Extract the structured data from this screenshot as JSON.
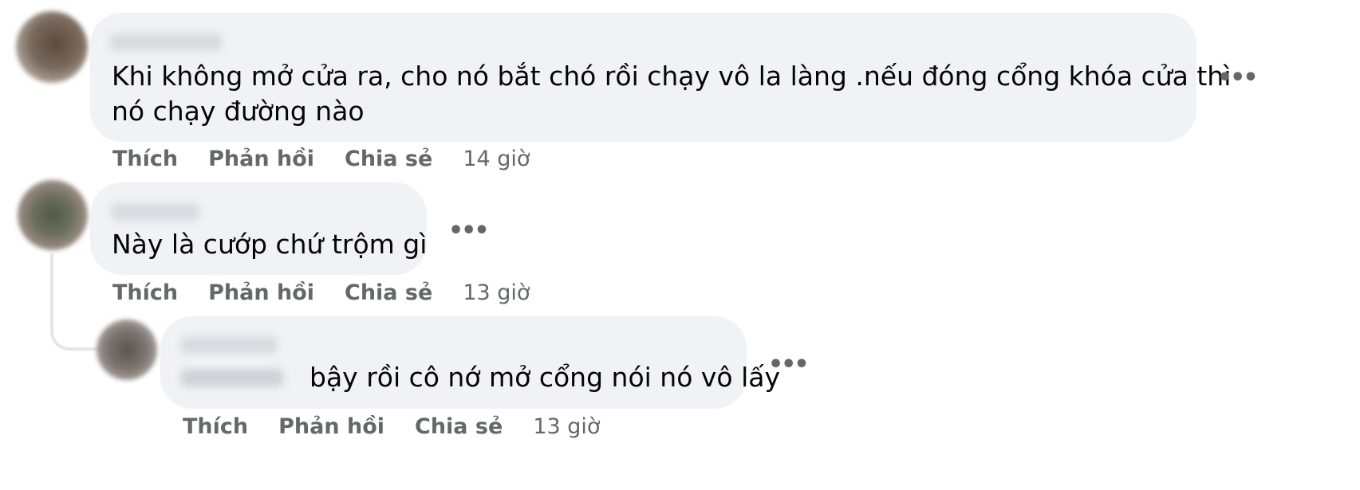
{
  "comments": [
    {
      "text_line1": "Khi không mở cửa ra, cho nó bắt chó rồi chạy vô la làng .nếu đóng cổng khóa cửa thì",
      "text_line2": "nó chạy đường nào",
      "actions": {
        "like": "Thích",
        "reply": "Phản hồi",
        "share": "Chia sẻ"
      },
      "time": "14 giờ",
      "more": "•••"
    },
    {
      "text": "Này là cướp chứ trộm gì",
      "actions": {
        "like": "Thích",
        "reply": "Phản hồi",
        "share": "Chia sẻ"
      },
      "time": "13 giờ",
      "more": "•••"
    },
    {
      "text": "bậy rồi cô nớ mở cổng nói nó vô lấy",
      "actions": {
        "like": "Thích",
        "reply": "Phản hồi",
        "share": "Chia sẻ"
      },
      "time": "13 giờ",
      "more": "•••"
    }
  ],
  "colors": {
    "bubble": "#f0f2f5",
    "text": "#050505",
    "meta": "#65676b",
    "thread_line": "#e4e6eb"
  }
}
